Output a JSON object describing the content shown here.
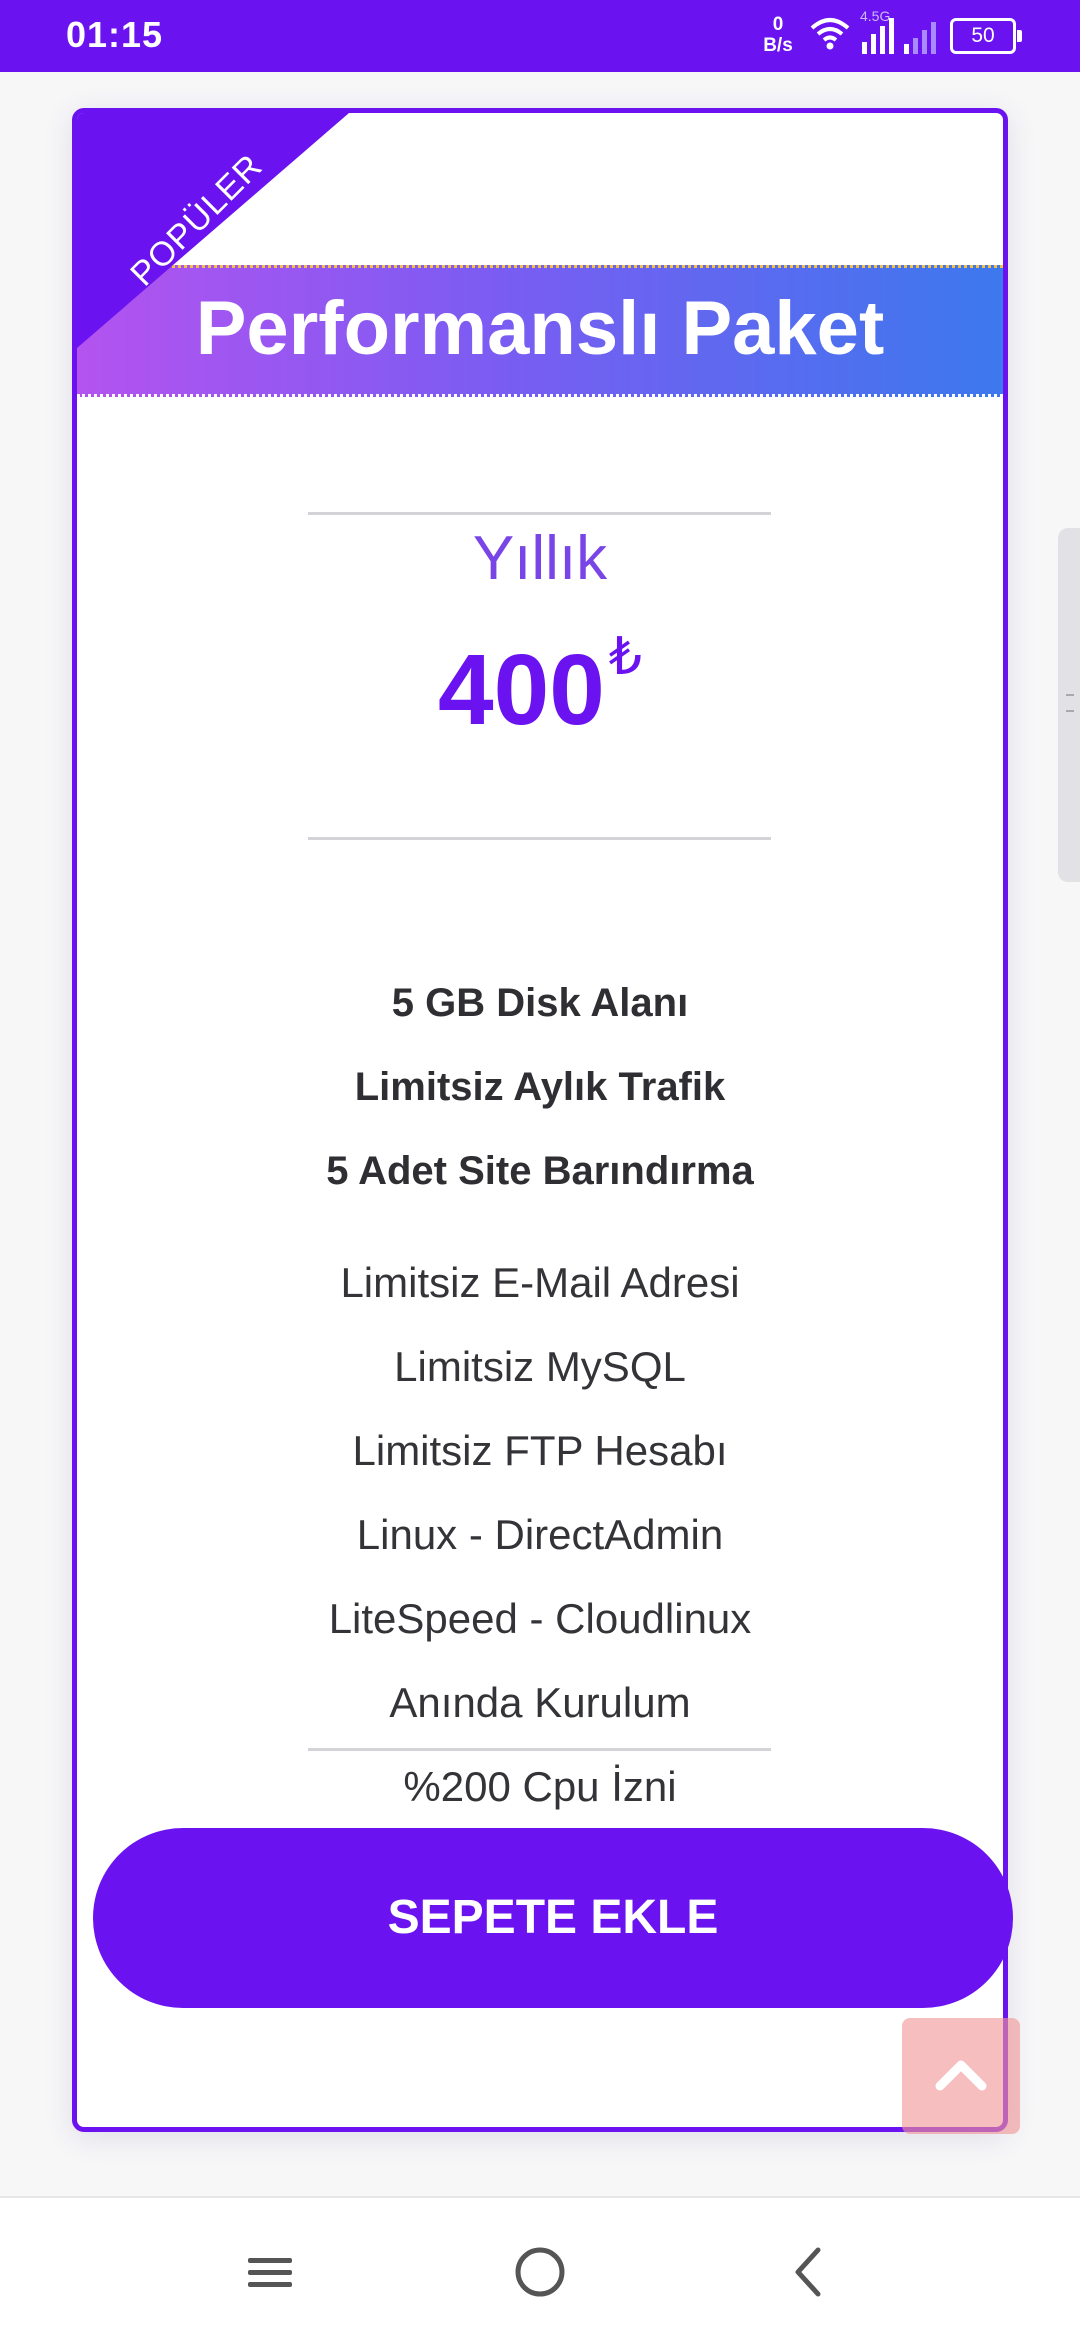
{
  "status_bar": {
    "time": "01:15",
    "net_speed_value": "0",
    "net_speed_unit": "B/s",
    "network_type": "4.5G",
    "battery": "50",
    "icons": [
      "wifi-icon",
      "signal-strength-icon",
      "signal-strength-icon",
      "battery-icon"
    ]
  },
  "card": {
    "ribbon": "POPÜLER",
    "title": "Performanslı Paket",
    "period": "Yıllık",
    "price": "400",
    "currency": "₺",
    "features_highlight": [
      "5 GB Disk Alanı",
      "Limitsiz Aylık Trafik",
      "5 Adet Site Barındırma"
    ],
    "features": [
      "Limitsiz E-Mail Adresi",
      "Limitsiz MySQL",
      "Limitsiz FTP Hesabı",
      "Linux - DirectAdmin",
      "LiteSpeed - Cloudlinux",
      "Anında Kurulum",
      "%200 Cpu İzni"
    ],
    "button_label": "SEPETE EKLE"
  },
  "colors": {
    "brand": "#6a12ef",
    "header_gradient": [
      "#b453f0",
      "#7b5cf2",
      "#3c78ee"
    ],
    "scroll_top_button": "#f09696"
  },
  "navigation": {
    "icons": [
      "menu-icon",
      "home-icon",
      "back-icon"
    ]
  }
}
